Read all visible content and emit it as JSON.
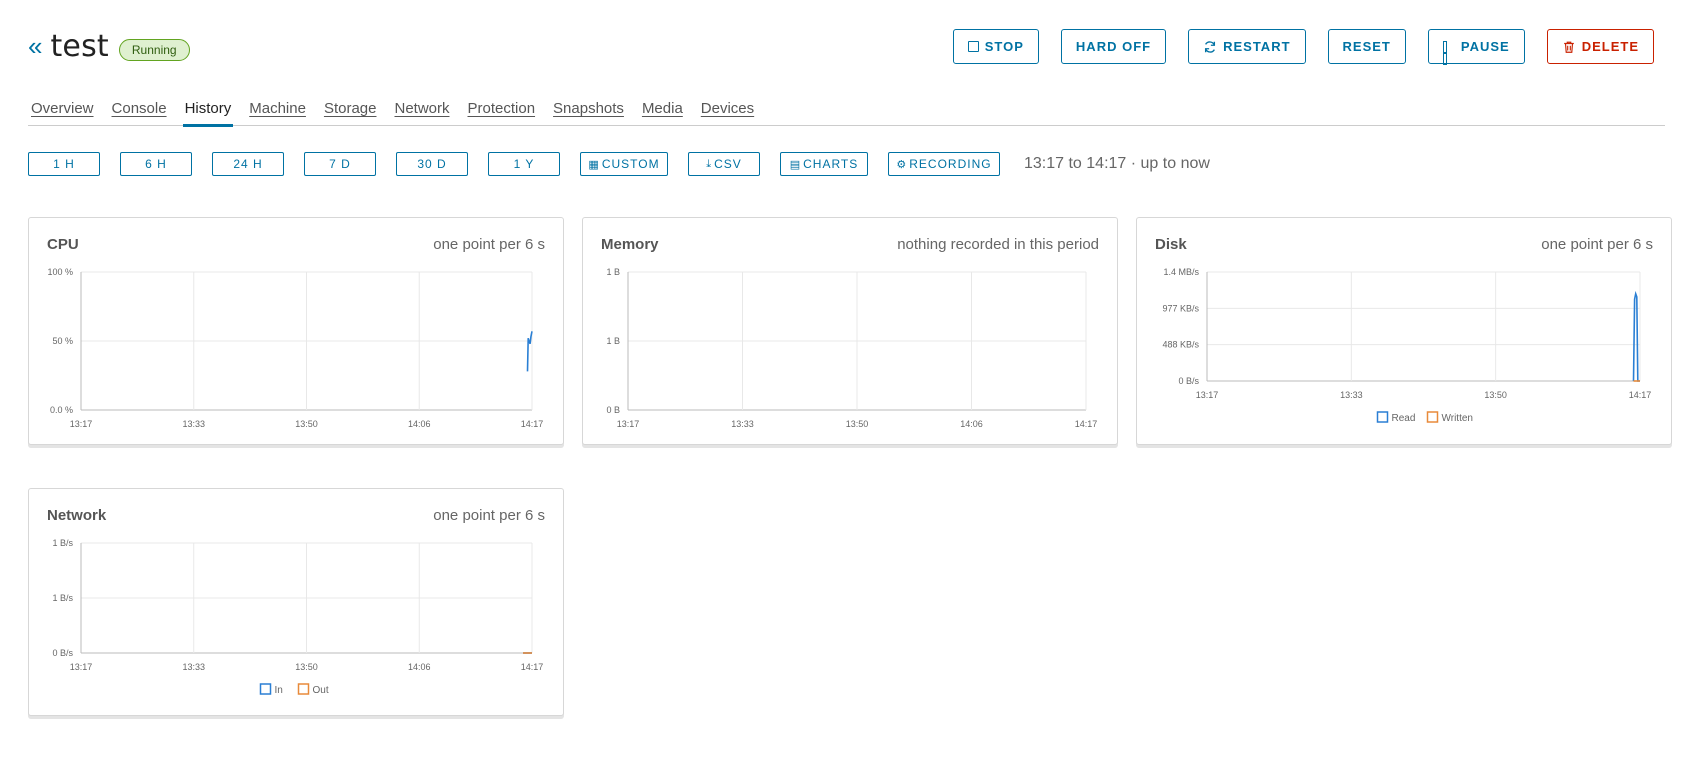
{
  "header": {
    "title": "test",
    "status": "Running",
    "actions": [
      {
        "id": "stop",
        "label": "STOP",
        "icon": "stop-icon"
      },
      {
        "id": "hard-off",
        "label": "HARD OFF",
        "icon": ""
      },
      {
        "id": "restart",
        "label": "RESTART",
        "icon": "restart-icon"
      },
      {
        "id": "reset",
        "label": "RESET",
        "icon": ""
      },
      {
        "id": "pause",
        "label": "PAUSE",
        "icon": "pause-icon"
      },
      {
        "id": "delete",
        "label": "DELETE",
        "icon": "trash-icon",
        "danger": true
      }
    ]
  },
  "tabs": [
    {
      "label": "Overview"
    },
    {
      "label": "Console"
    },
    {
      "label": "History",
      "active": true
    },
    {
      "label": "Machine"
    },
    {
      "label": "Storage"
    },
    {
      "label": "Network"
    },
    {
      "label": "Protection"
    },
    {
      "label": "Snapshots"
    },
    {
      "label": "Media"
    },
    {
      "label": "Devices"
    }
  ],
  "range": {
    "buttons": [
      {
        "label": "1 H"
      },
      {
        "label": "6 H"
      },
      {
        "label": "24 H"
      },
      {
        "label": "7 D"
      },
      {
        "label": "30 D"
      },
      {
        "label": "1 Y"
      }
    ],
    "custom_label": "CUSTOM",
    "csv_label": "CSV",
    "charts_label": "CHARTS",
    "recording_label": "RECORDING",
    "period_text": "13:17 to 14:17 · up to now"
  },
  "colors": {
    "accent": "#0072a3",
    "danger": "#c92100",
    "series_1": "#2a7fd4",
    "series_2": "#e88a3a",
    "grid": "#e8e8e8"
  },
  "chart_data": [
    {
      "type": "line",
      "title": "CPU",
      "note": "one point per 6 s",
      "x_ticks": [
        "13:17",
        "13:33",
        "13:50",
        "14:06",
        "14:17"
      ],
      "y_ticks": [
        "0.0 %",
        "50 %",
        "100 %"
      ],
      "ylim": [
        0,
        100
      ],
      "x_range_minutes": [
        0,
        60
      ],
      "series": [
        {
          "x": [
            59.4,
            59.5,
            59.6,
            59.75,
            59.85,
            60.0
          ],
          "values": [
            28,
            52,
            50,
            48,
            53,
            57
          ]
        }
      ]
    },
    {
      "type": "line",
      "title": "Memory",
      "note": "nothing recorded in this period",
      "x_ticks": [
        "13:17",
        "13:33",
        "13:50",
        "14:06",
        "14:17"
      ],
      "y_ticks": [
        "0 B",
        "1 B",
        "1 B"
      ],
      "ylim": [
        0,
        1
      ],
      "x_range_minutes": [
        0,
        60
      ],
      "series": []
    },
    {
      "type": "line",
      "title": "Disk",
      "note": "one point per 6 s",
      "x_ticks": [
        "13:17",
        "13:33",
        "13:50",
        "14:17"
      ],
      "y_ticks": [
        "0 B/s",
        "488 KB/s",
        "977 KB/s",
        "1.4 MB/s"
      ],
      "ylim": [
        0,
        1.4
      ],
      "x_range_minutes": [
        0,
        60
      ],
      "legend": [
        "Read",
        "Written"
      ],
      "series": [
        {
          "name": "Read",
          "x": [
            59.1,
            59.25,
            59.4,
            59.55,
            59.7,
            59.85,
            60.0
          ],
          "values": [
            0,
            1.05,
            1.12,
            1.08,
            0,
            0,
            0
          ]
        },
        {
          "name": "Written",
          "x": [
            59.1,
            60.0
          ],
          "values": [
            0,
            0
          ]
        }
      ]
    },
    {
      "type": "line",
      "title": "Network",
      "note": "one point per 6 s",
      "x_ticks": [
        "13:17",
        "13:33",
        "13:50",
        "14:06",
        "14:17"
      ],
      "y_ticks": [
        "0 B/s",
        "1 B/s",
        "1 B/s"
      ],
      "ylim": [
        0,
        1
      ],
      "x_range_minutes": [
        0,
        60
      ],
      "legend": [
        "In",
        "Out"
      ],
      "series": [
        {
          "name": "In",
          "x": [
            58.8,
            60.0
          ],
          "values": [
            0,
            0
          ]
        },
        {
          "name": "Out",
          "x": [
            58.8,
            60.0
          ],
          "values": [
            0,
            0
          ]
        }
      ]
    }
  ]
}
